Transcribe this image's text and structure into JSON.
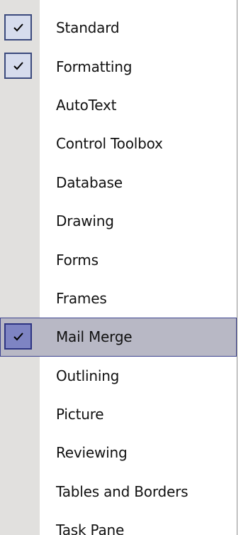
{
  "menu": {
    "items": [
      {
        "label": "Standard",
        "checked": true,
        "selected": false
      },
      {
        "label": "Formatting",
        "checked": true,
        "selected": false
      },
      {
        "label": "AutoText",
        "checked": false,
        "selected": false
      },
      {
        "label": "Control Toolbox",
        "checked": false,
        "selected": false
      },
      {
        "label": "Database",
        "checked": false,
        "selected": false
      },
      {
        "label": "Drawing",
        "checked": false,
        "selected": false
      },
      {
        "label": "Forms",
        "checked": false,
        "selected": false
      },
      {
        "label": "Frames",
        "checked": false,
        "selected": false
      },
      {
        "label": "Mail Merge",
        "checked": true,
        "selected": true
      },
      {
        "label": "Outlining",
        "checked": false,
        "selected": false
      },
      {
        "label": "Picture",
        "checked": false,
        "selected": false
      },
      {
        "label": "Reviewing",
        "checked": false,
        "selected": false
      },
      {
        "label": "Tables and Borders",
        "checked": false,
        "selected": false
      },
      {
        "label": "Task Pane",
        "checked": false,
        "selected": false
      }
    ]
  },
  "icons": {
    "check": "checkmark-icon"
  },
  "colors": {
    "gutter": "#e1e0de",
    "checkbox_fill": "#d6dced",
    "checkbox_border": "#3b4a7d",
    "selected_row": "#b8b8c5",
    "selected_checkbox": "#7e84c3"
  }
}
